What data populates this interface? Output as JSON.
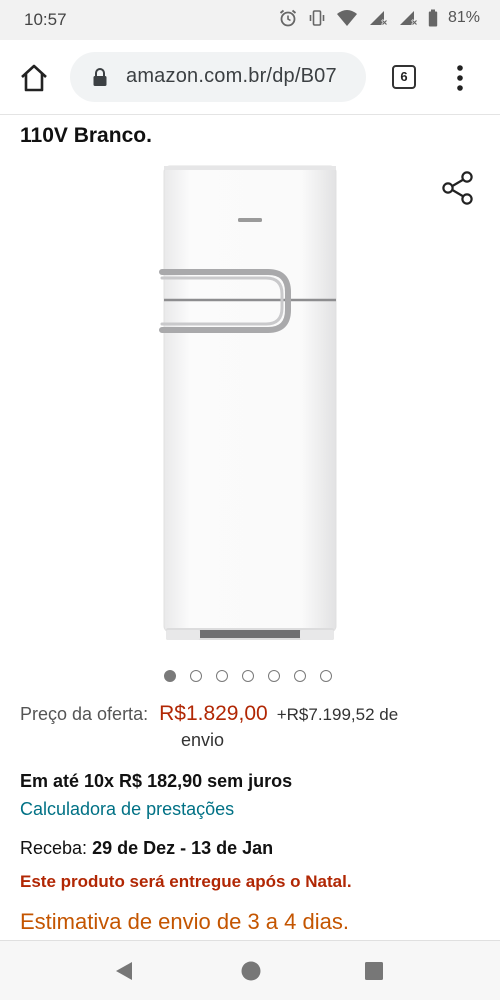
{
  "status_bar": {
    "time": "10:57",
    "battery": "81%",
    "icons": [
      "alarm-icon",
      "vibrate-icon",
      "wifi-icon",
      "signal-icon-1",
      "signal-icon-2",
      "battery-icon"
    ]
  },
  "browser": {
    "url": "amazon.com.br/dp/B07",
    "tab_count": "6",
    "icons": [
      "home-icon",
      "lock-icon",
      "more-vert-icon"
    ]
  },
  "product": {
    "title_line": "110V Branco.",
    "share_icon": "share-icon",
    "image_alt": "refrigerator-image",
    "carousel": {
      "count": 7,
      "active_index": 0
    },
    "price_label": "Preço da oferta:",
    "price": "R$1.829,00",
    "shipping_fee": "+R$7.199,52 de",
    "shipping_word": "envio",
    "installments": "Em até 10x R$ 182,90 sem juros",
    "calculator_link": "Calculadora de prestações",
    "delivery_label": "Receba:",
    "delivery_dates": "29 de Dez - 13 de Jan",
    "christmas_note": "Este produto será entregue após o Natal.",
    "shipping_estimate": "Estimativa de envio de 3 a 4 dias."
  },
  "colors": {
    "price": "#b12704",
    "link": "#007185",
    "estimate": "#c45500"
  },
  "nav_bar": {
    "icons": [
      "back-icon",
      "home-circle-icon",
      "recents-icon"
    ]
  }
}
